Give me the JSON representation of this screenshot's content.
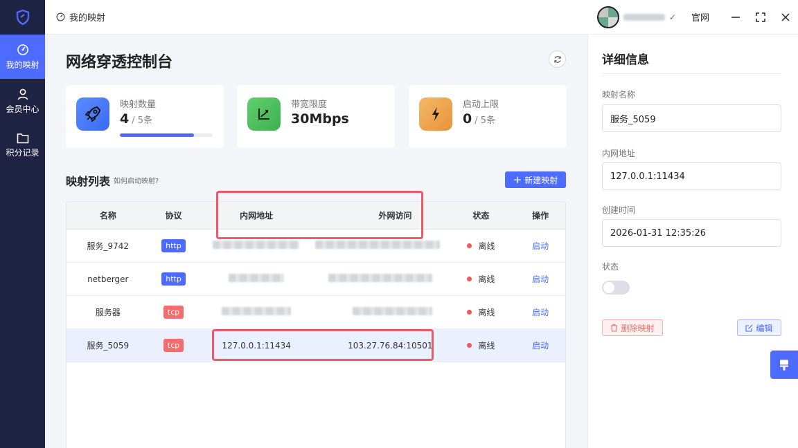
{
  "topbar": {
    "breadcrumb": "我的映射",
    "official_label": "官网",
    "check_mark": "✓"
  },
  "sidebar": {
    "items": [
      {
        "label": "我的映射",
        "icon": "gauge-icon",
        "active": true
      },
      {
        "label": "会员中心",
        "icon": "user-icon",
        "active": false
      },
      {
        "label": "积分记录",
        "icon": "folder-icon",
        "active": false
      }
    ]
  },
  "main": {
    "title": "网络穿透控制台",
    "stats": [
      {
        "label": "映射数量",
        "value": "4",
        "sub": "/ 5条",
        "progress": 0.8,
        "icon": "rocket-icon",
        "color": "#4d7cfe"
      },
      {
        "label": "带宽限度",
        "value": "30Mbps",
        "sub": "",
        "icon": "chart-up-icon",
        "color": "#4cc25f"
      },
      {
        "label": "启动上限",
        "value": "0",
        "sub": "/ 5条",
        "icon": "lightning-icon",
        "color": "#f0a04b"
      }
    ],
    "list_title": "映射列表",
    "list_hint": "如何启动映射?",
    "new_button": "新建映射",
    "table": {
      "headers": {
        "name": "名称",
        "protocol": "协议",
        "inner": "内网地址",
        "outer": "外网访问",
        "status": "状态",
        "op": "操作"
      },
      "rows": [
        {
          "name": "服务_9742",
          "protocol": "http",
          "inner": "",
          "outer": "",
          "status": "离线",
          "op": "启动"
        },
        {
          "name": "netberger",
          "protocol": "http",
          "inner": "",
          "outer": "",
          "status": "离线",
          "op": "启动"
        },
        {
          "name": "服务器",
          "protocol": "tcp",
          "inner": "",
          "outer": "",
          "status": "离线",
          "op": "启动"
        },
        {
          "name": "服务_5059",
          "protocol": "tcp",
          "inner": "127.0.0.1:11434",
          "outer": "103.27.76.84:10501",
          "status": "离线",
          "op": "启动"
        }
      ]
    }
  },
  "panel": {
    "title": "详细信息",
    "name_label": "映射名称",
    "name_value": "服务_5059",
    "inner_label": "内网地址",
    "inner_value": "127.0.0.1:11434",
    "created_label": "创建时间",
    "created_value": "2026-01-31 12:35:26",
    "status_label": "状态",
    "delete_button": "删除映射",
    "edit_button": "编辑"
  },
  "colors": {
    "accent": "#4d6bfe",
    "sidebar_bg": "#1f2444",
    "offline_dot": "#f0585b",
    "highlight": "#ea5a6a"
  }
}
